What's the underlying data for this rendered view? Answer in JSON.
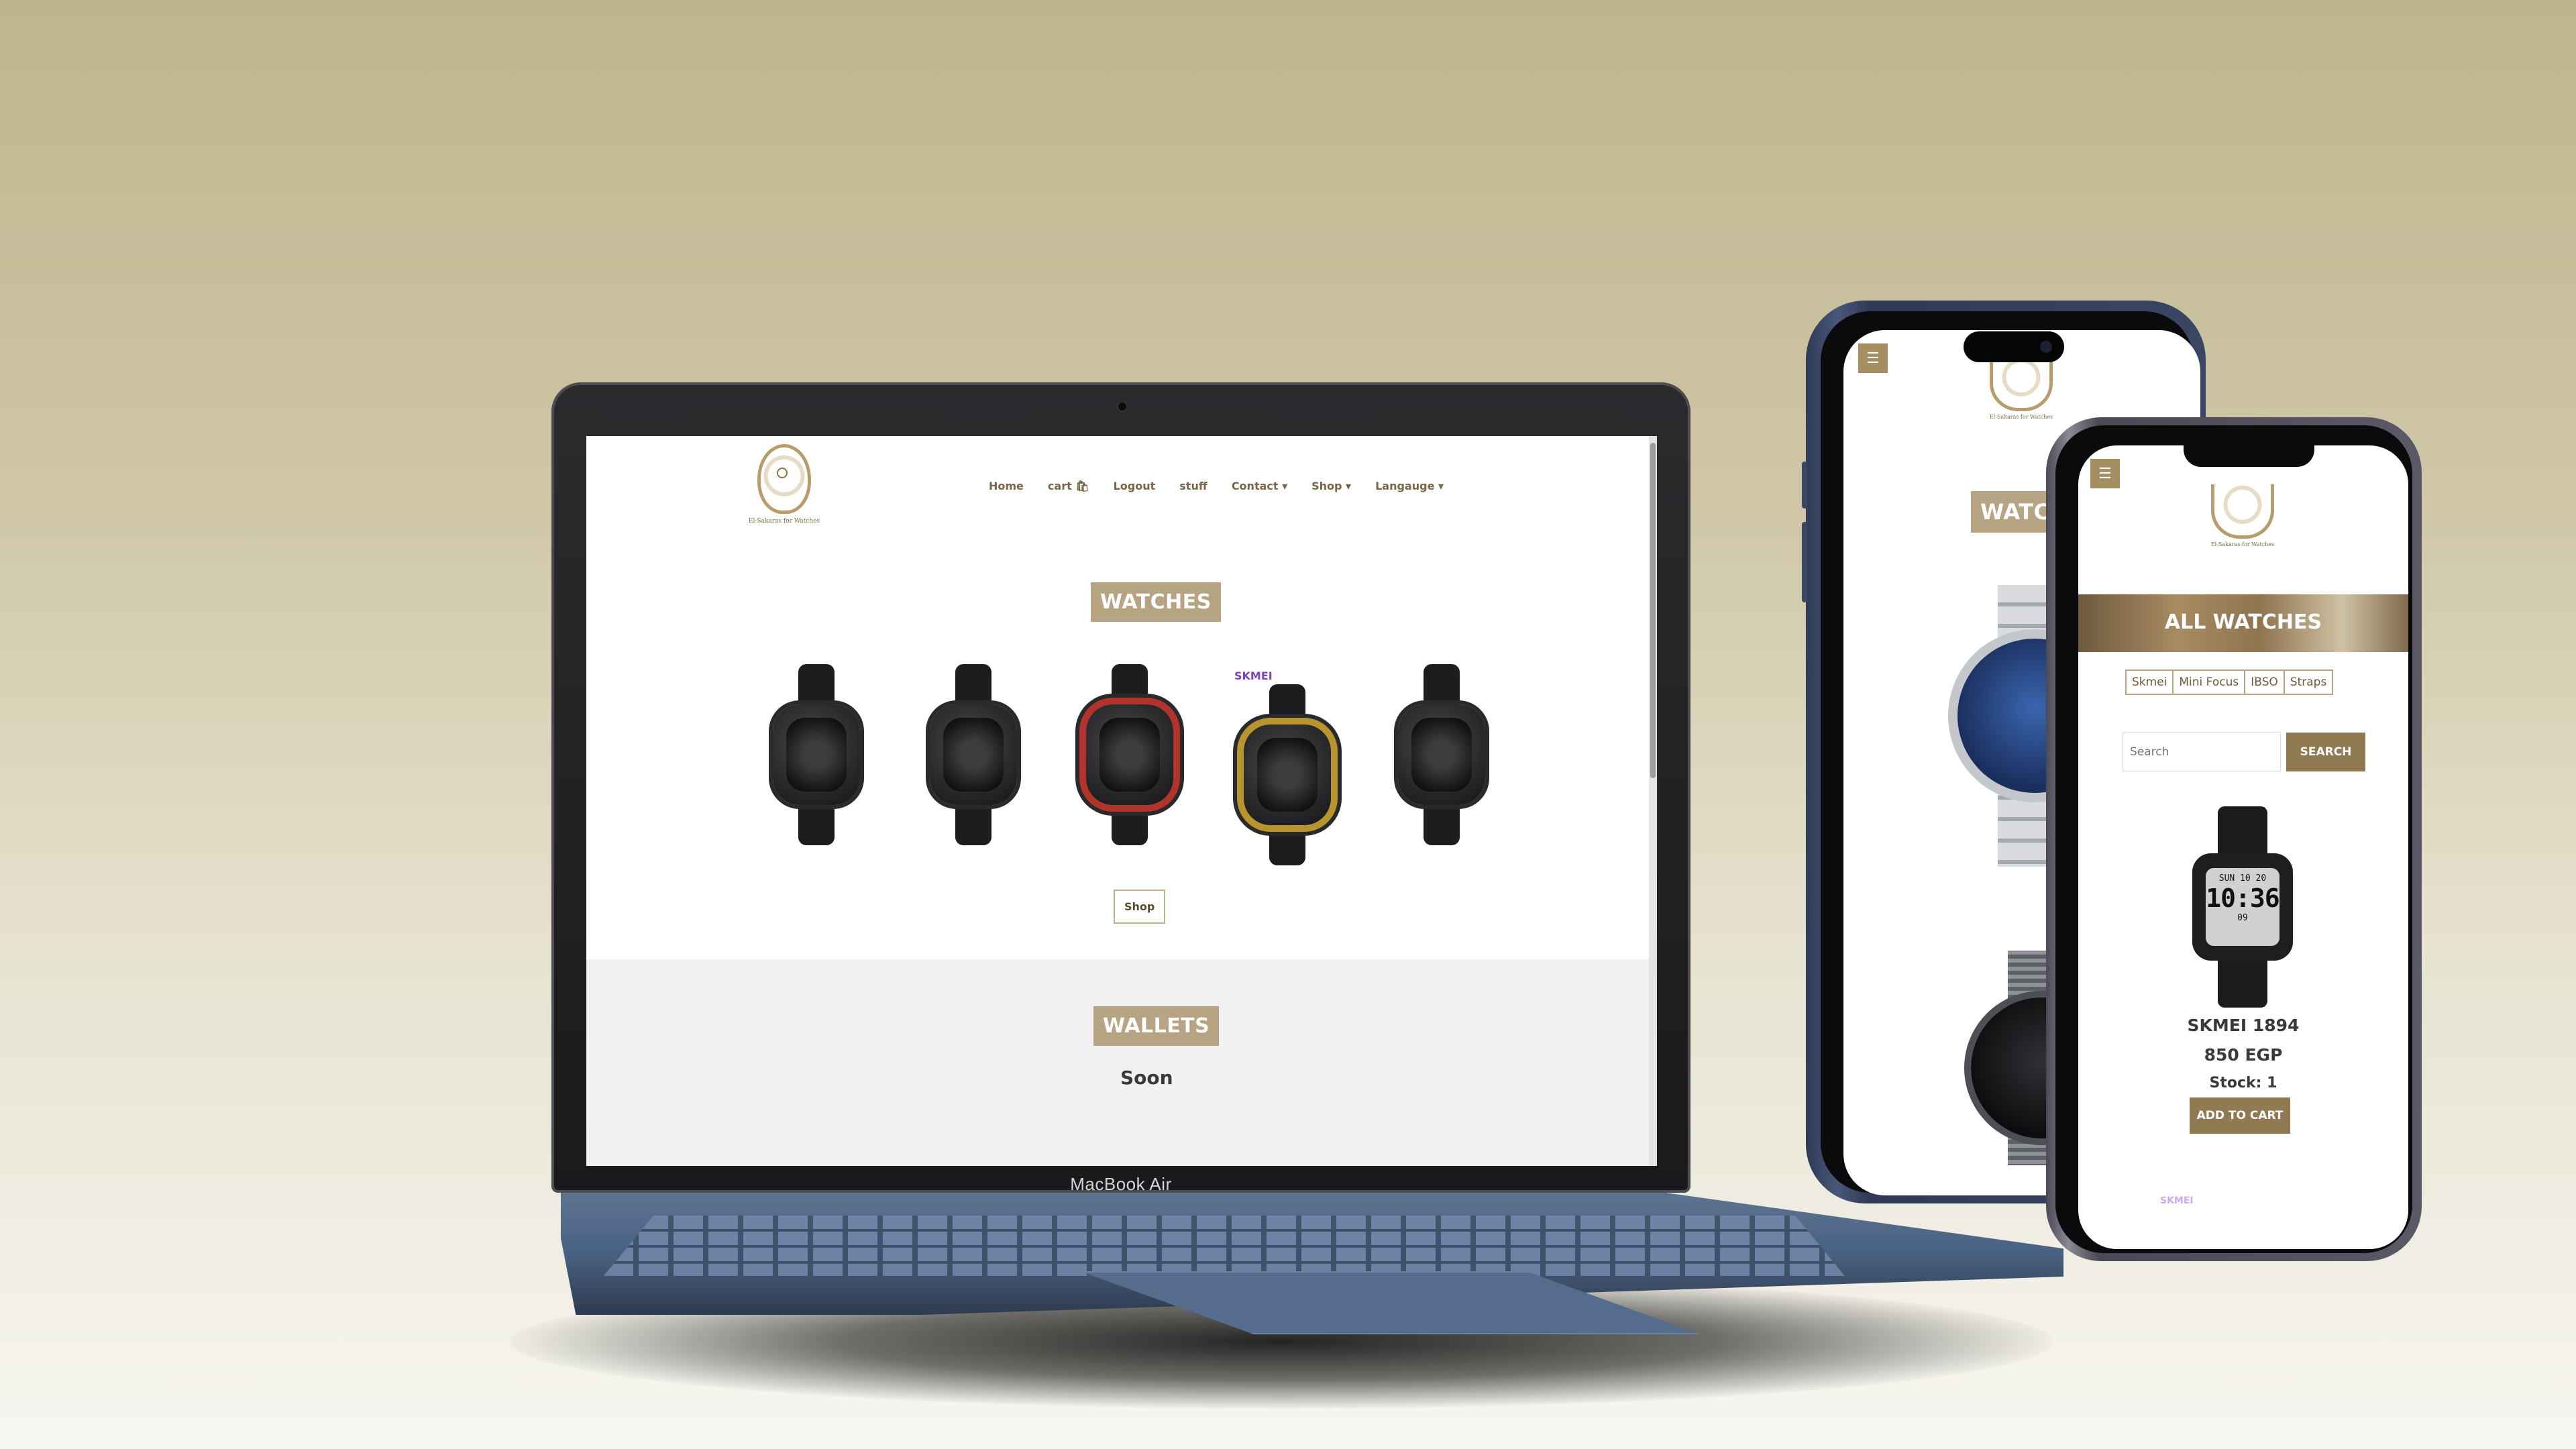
{
  "laptop": {
    "brand_label": "MacBook Air",
    "site": {
      "logo_caption": "El-Sakaras for Watches",
      "nav": [
        {
          "label": "Home"
        },
        {
          "label": "cart 🛍"
        },
        {
          "label": "Logout"
        },
        {
          "label": "stuff"
        },
        {
          "label": "Contact ▾"
        },
        {
          "label": "Shop ▾"
        },
        {
          "label": "Langauge ▾"
        }
      ],
      "watches_heading": "WATCHES",
      "brand_tag": "SKMEI",
      "shop_button": "Shop",
      "wallets_heading": "WALLETS",
      "wallets_status": "Soon"
    }
  },
  "phone_back": {
    "menu_icon": "☰",
    "logo_caption": "El-Sakaras for Watches",
    "heading_partial": "WATCH"
  },
  "phone_front": {
    "menu_icon": "☰",
    "logo_caption": "El-Sakaras for Watches",
    "hero_title": "ALL WATCHES",
    "filters": [
      "Skmei",
      "Mini Focus",
      "IBSO",
      "Straps"
    ],
    "search": {
      "placeholder": "Search",
      "button": "SEARCH"
    },
    "product": {
      "lcd_top": "SUN 10 20",
      "lcd_time": "10:36",
      "lcd_bottom": "09",
      "name": "SKMEI 1894",
      "price": "850 EGP",
      "stock": "Stock: 1",
      "add_to_cart": "ADD TO CART"
    },
    "footer_tag": "SKMEI"
  },
  "colors": {
    "brand_gold": "#b6a482",
    "button_brown": "#8f7a52",
    "nav_text": "#7a6544"
  }
}
